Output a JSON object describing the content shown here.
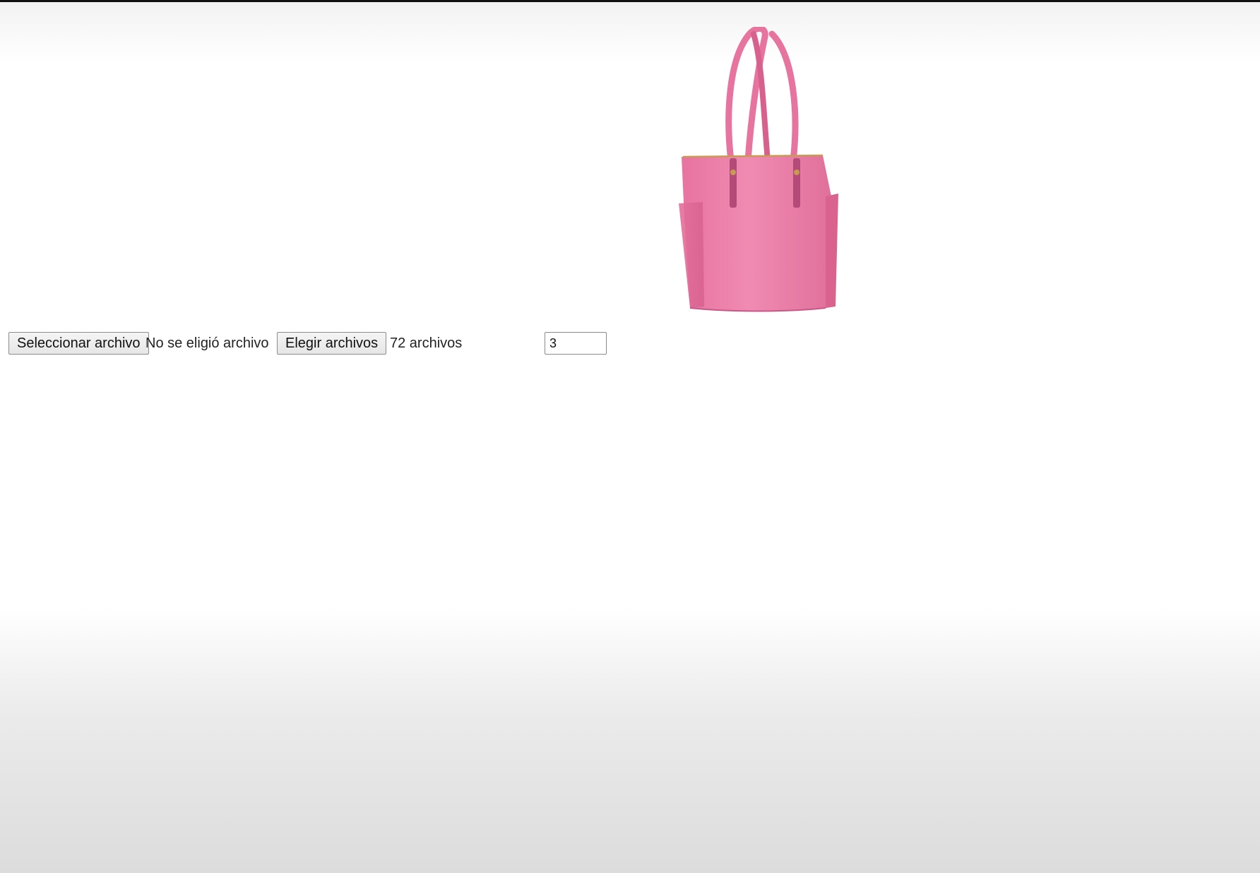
{
  "single_file": {
    "button_label": "Seleccionar archivo",
    "status": "No se eligió archivo"
  },
  "multi_file": {
    "button_label": "Elegir archivos",
    "status": "72 archivos"
  },
  "count_input": {
    "value": "3"
  },
  "product_image": {
    "icon": "pink-tote-handbag-image",
    "bag_color": "#ec7fa9",
    "trim_color": "#c8578a"
  }
}
